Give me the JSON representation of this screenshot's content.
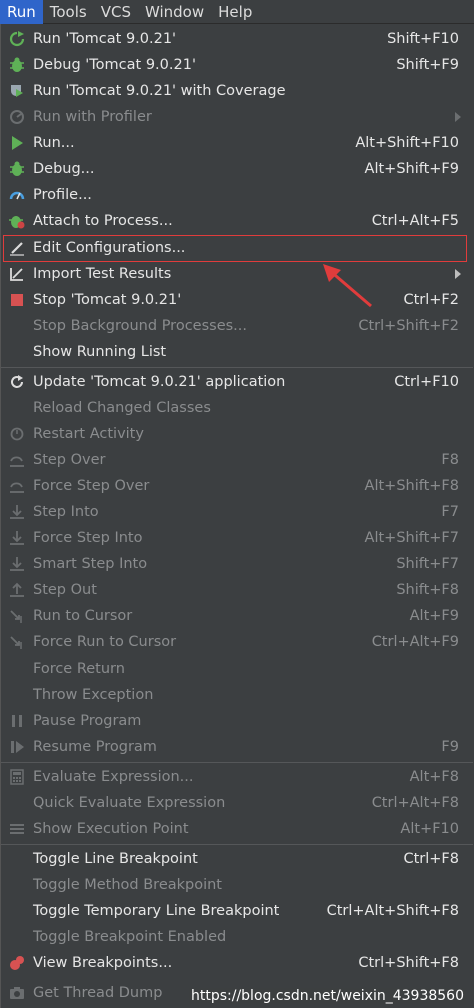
{
  "menubar": {
    "items": [
      "Run",
      "Tools",
      "VCS",
      "Window",
      "Help"
    ]
  },
  "menu": {
    "items": [
      {
        "label": "Run 'Tomcat 9.0.21'",
        "shortcut": "Shift+F10",
        "icon": "run-tomcat-icon",
        "enabled": true
      },
      {
        "label": "Debug 'Tomcat 9.0.21'",
        "shortcut": "Shift+F9",
        "icon": "debug-icon",
        "enabled": true
      },
      {
        "label": "Run 'Tomcat 9.0.21' with Coverage",
        "shortcut": "",
        "icon": "coverage-icon",
        "enabled": true
      },
      {
        "label": "Run with Profiler",
        "shortcut": "",
        "icon": "profiler-icon",
        "enabled": false,
        "submenu": true
      },
      {
        "label": "Run...",
        "shortcut": "Alt+Shift+F10",
        "icon": "run-icon",
        "enabled": true
      },
      {
        "label": "Debug...",
        "shortcut": "Alt+Shift+F9",
        "icon": "debug-icon",
        "enabled": true
      },
      {
        "label": "Profile...",
        "shortcut": "",
        "icon": "profile-icon",
        "enabled": true
      },
      {
        "label": "Attach to Process...",
        "shortcut": "Ctrl+Alt+F5",
        "icon": "attach-icon",
        "enabled": true
      },
      {
        "label": "Edit Configurations...",
        "shortcut": "",
        "icon": "edit-icon",
        "enabled": true
      },
      {
        "label": "Import Test Results",
        "shortcut": "",
        "icon": "import-icon",
        "enabled": true,
        "submenu": true
      },
      {
        "label": "Stop 'Tomcat 9.0.21'",
        "shortcut": "Ctrl+F2",
        "icon": "stop-icon",
        "enabled": true
      },
      {
        "label": "Stop Background Processes...",
        "shortcut": "Ctrl+Shift+F2",
        "icon": "",
        "enabled": false
      },
      {
        "label": "Show Running List",
        "shortcut": "",
        "icon": "",
        "enabled": true
      },
      {
        "label": "Update 'Tomcat 9.0.21' application",
        "shortcut": "Ctrl+F10",
        "icon": "update-icon",
        "enabled": true
      },
      {
        "label": "Reload Changed Classes",
        "shortcut": "",
        "icon": "",
        "enabled": false
      },
      {
        "label": "Restart Activity",
        "shortcut": "",
        "icon": "restart-icon",
        "enabled": false
      },
      {
        "label": "Step Over",
        "shortcut": "F8",
        "icon": "step-over-icon",
        "enabled": false
      },
      {
        "label": "Force Step Over",
        "shortcut": "Alt+Shift+F8",
        "icon": "force-step-over-icon",
        "enabled": false
      },
      {
        "label": "Step Into",
        "shortcut": "F7",
        "icon": "step-into-icon",
        "enabled": false
      },
      {
        "label": "Force Step Into",
        "shortcut": "Alt+Shift+F7",
        "icon": "force-step-into-icon",
        "enabled": false
      },
      {
        "label": "Smart Step Into",
        "shortcut": "Shift+F7",
        "icon": "smart-step-into-icon",
        "enabled": false
      },
      {
        "label": "Step Out",
        "shortcut": "Shift+F8",
        "icon": "step-out-icon",
        "enabled": false
      },
      {
        "label": "Run to Cursor",
        "shortcut": "Alt+F9",
        "icon": "run-to-cursor-icon",
        "enabled": false
      },
      {
        "label": "Force Run to Cursor",
        "shortcut": "Ctrl+Alt+F9",
        "icon": "force-run-to-cursor-icon",
        "enabled": false
      },
      {
        "label": "Force Return",
        "shortcut": "",
        "icon": "",
        "enabled": false
      },
      {
        "label": "Throw Exception",
        "shortcut": "",
        "icon": "",
        "enabled": false
      },
      {
        "label": "Pause Program",
        "shortcut": "",
        "icon": "pause-icon",
        "enabled": false
      },
      {
        "label": "Resume Program",
        "shortcut": "F9",
        "icon": "resume-icon",
        "enabled": false
      },
      {
        "label": "Evaluate Expression...",
        "shortcut": "Alt+F8",
        "icon": "calculator-icon",
        "enabled": false
      },
      {
        "label": "Quick Evaluate Expression",
        "shortcut": "Ctrl+Alt+F8",
        "icon": "",
        "enabled": false
      },
      {
        "label": "Show Execution Point",
        "shortcut": "Alt+F10",
        "icon": "execution-point-icon",
        "enabled": false
      },
      {
        "label": "Toggle Line Breakpoint",
        "shortcut": "Ctrl+F8",
        "icon": "",
        "enabled": true
      },
      {
        "label": "Toggle Method Breakpoint",
        "shortcut": "",
        "icon": "",
        "enabled": false
      },
      {
        "label": "Toggle Temporary Line Breakpoint",
        "shortcut": "Ctrl+Alt+Shift+F8",
        "icon": "",
        "enabled": true
      },
      {
        "label": "Toggle Breakpoint Enabled",
        "shortcut": "",
        "icon": "",
        "enabled": false
      },
      {
        "label": "View Breakpoints...",
        "shortcut": "Ctrl+Shift+F8",
        "icon": "breakpoints-icon",
        "enabled": true
      },
      {
        "label": "Get Thread Dump",
        "shortcut": "",
        "icon": "camera-icon",
        "enabled": false
      }
    ]
  },
  "watermark": "https://blog.csdn.net/weixin_43938560",
  "colors": {
    "background": "#3c3f41",
    "menubar_active": "#2f65ca",
    "highlight_box": "#e03c3c",
    "disabled_text": "#8a8c8e"
  }
}
